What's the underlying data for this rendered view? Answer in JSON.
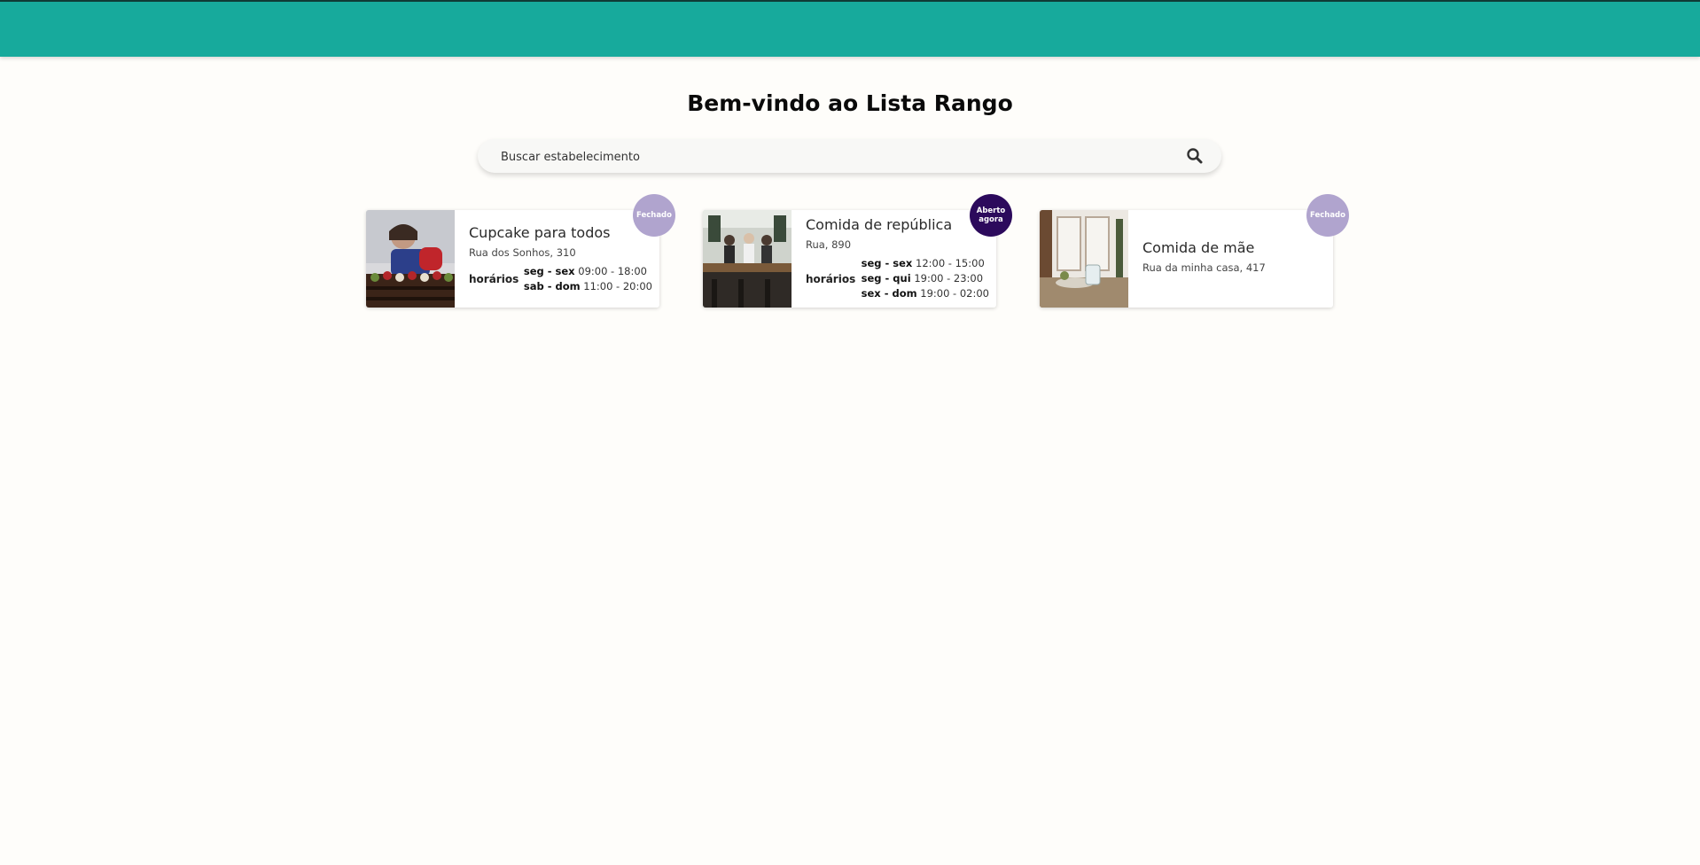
{
  "header": {
    "color": "#17aa9c"
  },
  "page": {
    "title": "Bem-vindo ao Lista Rango"
  },
  "search": {
    "placeholder": "Buscar estabelecimento",
    "icon": "search-icon"
  },
  "restaurants": [
    {
      "name": "Cupcake para todos",
      "address": "Rua dos Sonhos, 310",
      "status": "Fechado",
      "status_color": "#b0a4ce",
      "hours_label": "horários",
      "hours": [
        {
          "days": "seg - sex",
          "time": "09:00 - 18:00"
        },
        {
          "days": "sab - dom",
          "time": "11:00 - 20:00"
        }
      ]
    },
    {
      "name": "Comida de república",
      "address": "Rua, 890",
      "status": "Aberto agora",
      "status_color": "#2c0a5c",
      "hours_label": "horários",
      "hours": [
        {
          "days": "seg - sex",
          "time": "12:00 - 15:00"
        },
        {
          "days": "seg - qui",
          "time": "19:00 - 23:00"
        },
        {
          "days": "sex - dom",
          "time": "19:00 - 02:00"
        }
      ]
    },
    {
      "name": "Comida de mãe",
      "address": "Rua da minha casa, 417",
      "status": "Fechado",
      "status_color": "#b0a4ce"
    }
  ]
}
